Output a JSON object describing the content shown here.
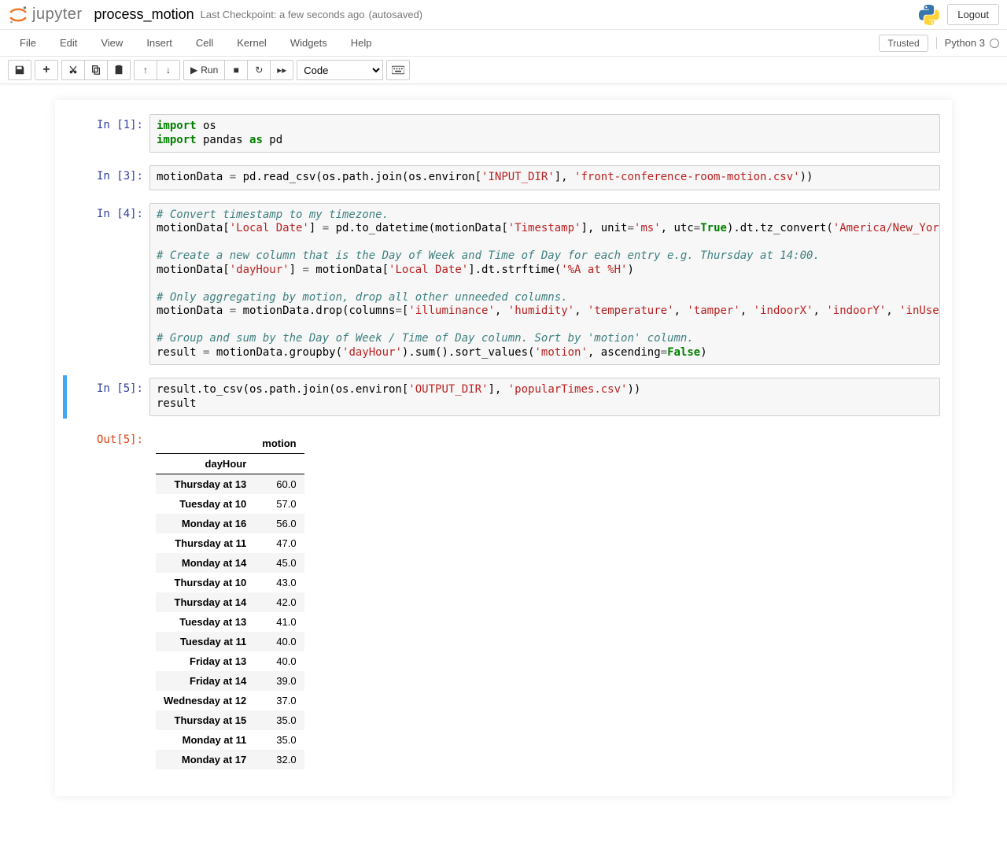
{
  "header": {
    "logo_text": "jupyter",
    "notebook_name": "process_motion",
    "checkpoint": "Last Checkpoint: a few seconds ago",
    "autosave": "(autosaved)",
    "logout": "Logout"
  },
  "menubar": {
    "items": [
      "File",
      "Edit",
      "View",
      "Insert",
      "Cell",
      "Kernel",
      "Widgets",
      "Help"
    ],
    "trusted": "Trusted",
    "kernel": "Python 3"
  },
  "toolbar": {
    "run_label": "Run",
    "cell_type": "Code"
  },
  "cells": [
    {
      "prompt": "In [1]:",
      "code_html": "<span class='kw'>import</span> os\n<span class='kw'>import</span> pandas <span class='kw'>as</span> pd"
    },
    {
      "prompt": "In [3]:",
      "code_html": "motionData <span class='op'>=</span> pd.read_csv(os.path.join(os.environ[<span class='str'>'INPUT_DIR'</span>], <span class='str'>'front-conference-room-motion.csv'</span>))"
    },
    {
      "prompt": "In [4]:",
      "code_html": "<span class='cm'># Convert timestamp to my timezone.</span>\nmotionData[<span class='str'>'Local Date'</span>] <span class='op'>=</span> pd.to_datetime(motionData[<span class='str'>'Timestamp'</span>], unit<span class='op'>=</span><span class='str'>'ms'</span>, utc<span class='op'>=</span><span class='bv'>True</span>).dt.tz_convert(<span class='str'>'America/New_York'</span>\n\n<span class='cm'># Create a new column that is the Day of Week and Time of Day for each entry e.g. Thursday at 14:00.</span>\nmotionData[<span class='str'>'dayHour'</span>] <span class='op'>=</span> motionData[<span class='str'>'Local Date'</span>].dt.strftime(<span class='str'>'%A at %H'</span>)\n\n<span class='cm'># Only aggregating by motion, drop all other unneeded columns.</span>\nmotionData <span class='op'>=</span> motionData.drop(columns<span class='op'>=</span>[<span class='str'>'illuminance'</span>, <span class='str'>'humidity'</span>, <span class='str'>'temperature'</span>, <span class='str'>'tamper'</span>, <span class='str'>'indoorX'</span>, <span class='str'>'indoorY'</span>, <span class='str'>'inUse'</span>\n\n<span class='cm'># Group and sum by the Day of Week / Time of Day column. Sort by 'motion' column.</span>\nresult <span class='op'>=</span> motionData.groupby(<span class='str'>'dayHour'</span>).sum().sort_values(<span class='str'>'motion'</span>, ascending<span class='op'>=</span><span class='bv'>False</span>)"
    },
    {
      "prompt": "In [5]:",
      "selected": true,
      "code_html": "result.to_csv(os.path.join(os.environ[<span class='str'>'OUTPUT_DIR'</span>], <span class='str'>'popularTimes.csv'</span>))\nresult",
      "out_prompt": "Out[5]:",
      "output_table": {
        "col_header": "motion",
        "index_name": "dayHour",
        "rows": [
          {
            "idx": "Thursday at 13",
            "val": "60.0"
          },
          {
            "idx": "Tuesday at 10",
            "val": "57.0"
          },
          {
            "idx": "Monday at 16",
            "val": "56.0"
          },
          {
            "idx": "Thursday at 11",
            "val": "47.0"
          },
          {
            "idx": "Monday at 14",
            "val": "45.0"
          },
          {
            "idx": "Thursday at 10",
            "val": "43.0"
          },
          {
            "idx": "Thursday at 14",
            "val": "42.0"
          },
          {
            "idx": "Tuesday at 13",
            "val": "41.0"
          },
          {
            "idx": "Tuesday at 11",
            "val": "40.0"
          },
          {
            "idx": "Friday at 13",
            "val": "40.0"
          },
          {
            "idx": "Friday at 14",
            "val": "39.0"
          },
          {
            "idx": "Wednesday at 12",
            "val": "37.0"
          },
          {
            "idx": "Thursday at 15",
            "val": "35.0"
          },
          {
            "idx": "Monday at 11",
            "val": "35.0"
          },
          {
            "idx": "Monday at 17",
            "val": "32.0"
          }
        ]
      }
    }
  ]
}
